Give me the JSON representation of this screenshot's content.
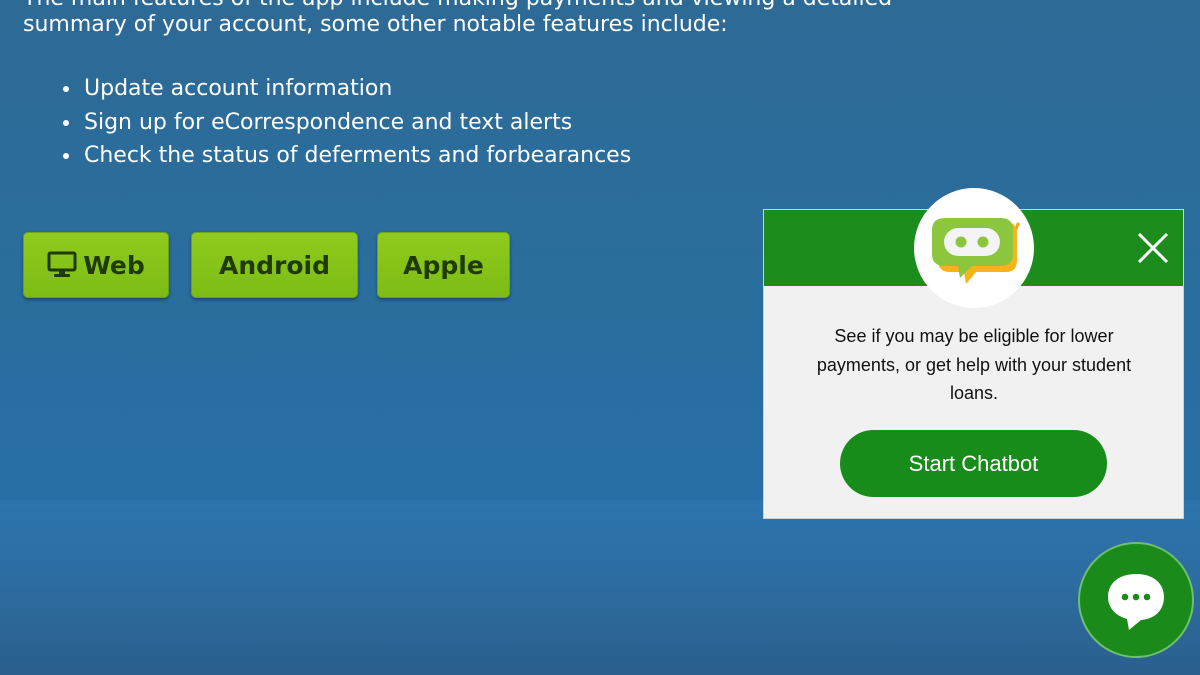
{
  "content": {
    "intro_line_partial": "The main features of the app include making payments and viewing a detailed",
    "intro_line": "summary of your account, some other notable features include:",
    "features": [
      "Update account information",
      "Sign up for eCorrespondence and text alerts",
      "Check the status of deferments and forbearances"
    ]
  },
  "buttons": {
    "web": {
      "label": "Web",
      "icon": "monitor-icon"
    },
    "android": {
      "label": "Android"
    },
    "apple": {
      "label": "Apple"
    }
  },
  "chat_popup": {
    "message": "See if you may be eligible for lower payments, or get help with your student loans.",
    "start_button": "Start Chatbot",
    "close_icon": "close-icon",
    "avatar_icon": "chatbot-robot-icon"
  },
  "chat_fab": {
    "icon": "chat-bubble-icon"
  },
  "colors": {
    "page_bg": "#2a6e9e",
    "button_green": "#85c41a",
    "button_text": "#1f3a07",
    "popup_green": "#1c8c1c",
    "start_button": "#178c1a",
    "popup_bg": "#f1f1f1"
  }
}
